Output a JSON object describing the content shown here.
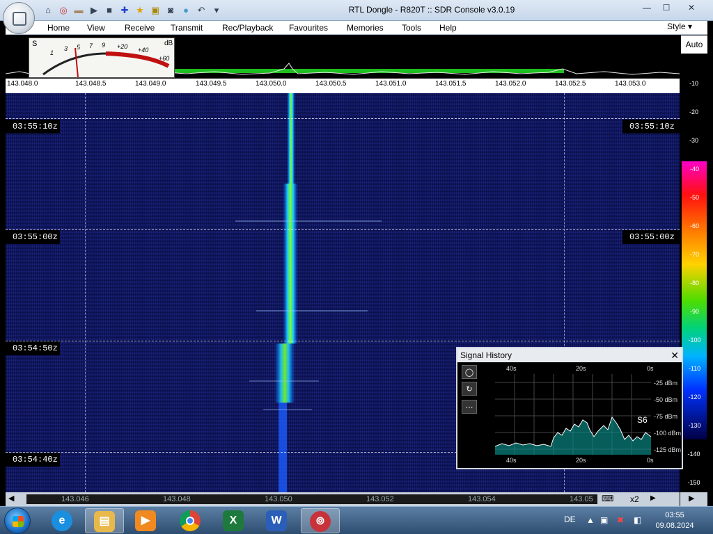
{
  "window": {
    "title": "RTL Dongle - R820T :: SDR Console v3.0.19",
    "minimize_icon": "minimize-icon",
    "maximize_icon": "maximize-icon",
    "close_icon": "close-icon",
    "minimize_glyph": "—",
    "maximize_glyph": "☐",
    "close_glyph": "✕"
  },
  "menu": {
    "items": [
      "Home",
      "View",
      "Receive",
      "Transmit",
      "Rec/Playback",
      "Favourites",
      "Memories",
      "Tools",
      "Help"
    ],
    "style_label": "Style"
  },
  "smeter": {
    "s_label": "S",
    "db_label": "dB",
    "ticks": [
      "1",
      "3",
      "5",
      "7",
      "9",
      "+20",
      "+40",
      "+60"
    ]
  },
  "frequency_axis": [
    "143.048.0",
    "143.048.5",
    "143.049.0",
    "143.049.5",
    "143.050.0",
    "143.050.5",
    "143.051.0",
    "143.051.5",
    "143.052.0",
    "143.052.5",
    "143.053.0"
  ],
  "waterfall": {
    "time_markers": [
      "03:55:10z",
      "03:55:00z",
      "03:54:50z",
      "03:54:40z"
    ]
  },
  "db_scale": {
    "auto_label": "Auto",
    "values": [
      "-10",
      "-20",
      "-30",
      "-40",
      "-50",
      "-60",
      "-70",
      "-80",
      "-90",
      "-100",
      "-110",
      "-120",
      "-130",
      "-140",
      "-150"
    ]
  },
  "bottom_axis": [
    "143.046",
    "143.048",
    "143.050",
    "143.052",
    "143.054",
    "143.05"
  ],
  "zoom": "x2",
  "signal_history": {
    "title": "Signal History",
    "time_labels": [
      "40s",
      "20s",
      "0s"
    ],
    "db_labels": [
      "-25 dBm",
      "-50 dBm",
      "-75 dBm",
      "-100 dBm",
      "-125 dBm"
    ],
    "s_reading": "S6"
  },
  "taskbar": {
    "language": "DE",
    "time": "03:55",
    "date": "09.08.2024",
    "apps": [
      "internet-explorer",
      "file-explorer",
      "media-player",
      "chrome",
      "excel",
      "word",
      "sdr-console"
    ]
  }
}
